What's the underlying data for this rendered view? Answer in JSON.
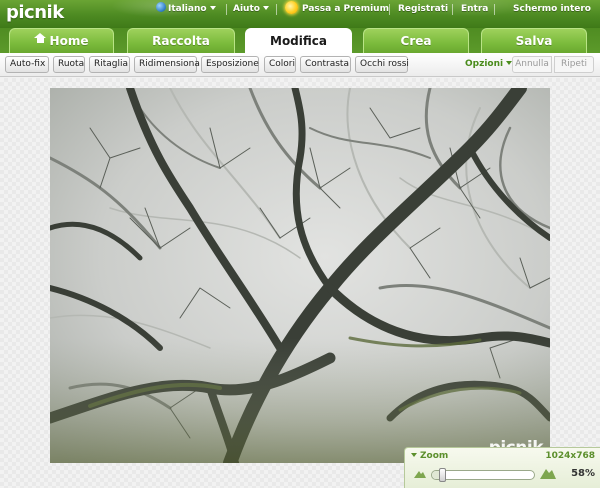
{
  "brand": {
    "logo": "picnik",
    "watermark": "picnik"
  },
  "top_nav": {
    "language": "Italiano",
    "help": "Aiuto",
    "premium": "Passa a Premium",
    "register": "Registrati",
    "login": "Entra",
    "fullscreen": "Schermo intero"
  },
  "main_tabs": [
    {
      "label": "Home",
      "icon": "home-icon",
      "active": false
    },
    {
      "label": "Raccolta",
      "active": false
    },
    {
      "label": "Modifica",
      "active": true
    },
    {
      "label": "Crea",
      "active": false
    },
    {
      "label": "Salva",
      "active": false
    }
  ],
  "toolbar": {
    "tools": [
      "Auto-fix",
      "Ruota",
      "Ritaglia",
      "Ridimensiona",
      "Esposizione",
      "Colori",
      "Contrasta",
      "Occhi rossi"
    ],
    "options": "Opzioni",
    "undo": "Annulla",
    "redo": "Ripeti"
  },
  "zoom": {
    "label": "Zoom",
    "dimensions": "1024x768",
    "percent": "58%",
    "level": 0.1
  },
  "colors": {
    "brand_green": "#5c9a2a",
    "active_tab": "#ffffff",
    "link_green": "#4a8b1c"
  }
}
